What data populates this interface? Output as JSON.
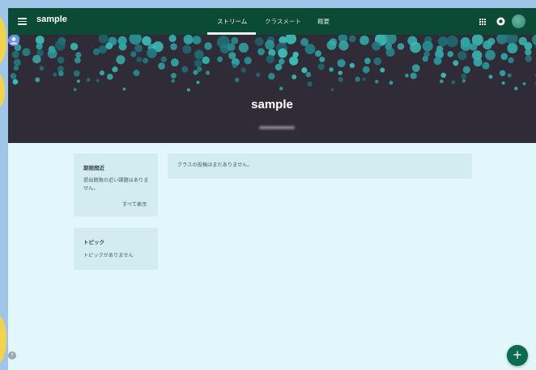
{
  "app": {
    "title": "sample"
  },
  "nav": {
    "tabs": [
      {
        "label": "ストリーム",
        "active": true
      },
      {
        "label": "クラスメート",
        "active": false
      },
      {
        "label": "概要",
        "active": false
      }
    ]
  },
  "header_icons": [
    "menu-icon",
    "apps-icon",
    "account-circle-icon",
    "avatar"
  ],
  "banner": {
    "class_name": "sample"
  },
  "upcoming": {
    "heading": "期限間近",
    "text": "提出期限の近い課題はありません。",
    "link": "すべて表示"
  },
  "topics": {
    "heading": "トピック",
    "text": "トピックがありません"
  },
  "stream": {
    "empty_message": "クラスの投稿はまだありません。"
  },
  "fab": {
    "symbol": "+"
  },
  "help": {
    "symbol": "?"
  },
  "colors": {
    "topbar": "#0b4a35",
    "banner": "#2f2c38",
    "banner_dots": "#2fa2a1",
    "page_bg": "#e2f7fb",
    "card_bg": "#d3ecef",
    "fab": "#0c6a51"
  }
}
